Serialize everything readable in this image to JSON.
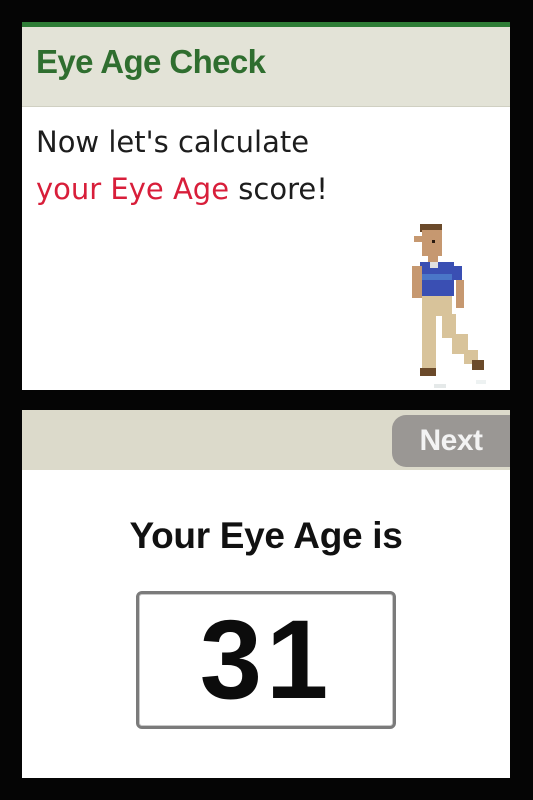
{
  "top_screen": {
    "title": "Eye Age Check",
    "message_line1": "Now let's calculate",
    "message_line2_red": "your Eye Age",
    "message_line2_rest": " score!"
  },
  "bottom_screen": {
    "next_label": "Next",
    "result_label": "Your Eye Age is",
    "result_value": "31"
  },
  "colors": {
    "title_green": "#2f6e2f",
    "highlight_red": "#d81e3a",
    "bar_beige": "#e3e3d7",
    "next_button_gray": "#9a9794"
  }
}
